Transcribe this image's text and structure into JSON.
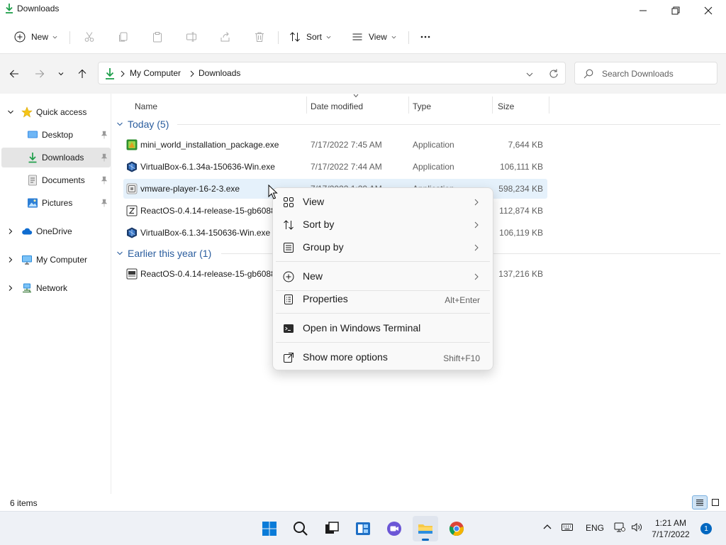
{
  "window": {
    "title": "Downloads"
  },
  "command_bar": {
    "new_label": "New",
    "sort_label": "Sort",
    "view_label": "View"
  },
  "address": {
    "crumbs": [
      "My Computer",
      "Downloads"
    ],
    "search_placeholder": "Search Downloads"
  },
  "nav": {
    "quick_access": "Quick access",
    "items": [
      {
        "label": "Desktop",
        "pinned": true
      },
      {
        "label": "Downloads",
        "pinned": true,
        "selected": true
      },
      {
        "label": "Documents",
        "pinned": true
      },
      {
        "label": "Pictures",
        "pinned": true
      }
    ],
    "onedrive": "OneDrive",
    "my_computer": "My Computer",
    "network": "Network"
  },
  "columns": {
    "name": "Name",
    "date": "Date modified",
    "type": "Type",
    "size": "Size"
  },
  "groups": [
    {
      "label": "Today (5)",
      "files": [
        {
          "name": "mini_world_installation_package.exe",
          "date": "7/17/2022 7:45 AM",
          "type": "Application",
          "size": "7,644 KB",
          "icon": "mini-world-app-icon"
        },
        {
          "name": "VirtualBox-6.1.34a-150636-Win.exe",
          "date": "7/17/2022 7:44 AM",
          "type": "Application",
          "size": "106,111 KB",
          "icon": "virtualbox-icon"
        },
        {
          "name": "vmware-player-16-2-3.exe",
          "date": "7/17/2022 1:20 AM",
          "type": "Application",
          "size": "598,234 KB",
          "icon": "vmware-icon"
        },
        {
          "name": "ReactOS-0.4.14-release-15-gb6088a",
          "date": "",
          "type": "",
          "size": "112,874 KB",
          "icon": "zip-archive-icon"
        },
        {
          "name": "VirtualBox-6.1.34-150636-Win.exe",
          "date": "",
          "type": "",
          "size": "106,119 KB",
          "icon": "virtualbox-icon"
        }
      ]
    },
    {
      "label": "Earlier this year (1)",
      "files": [
        {
          "name": "ReactOS-0.4.14-release-15-gb6088a",
          "date": "",
          "type": "",
          "size": "137,216 KB",
          "icon": "iso-disc-icon"
        }
      ]
    }
  ],
  "status": {
    "item_count": "6 items"
  },
  "context_menu": {
    "items": [
      {
        "label": "View",
        "submenu": true,
        "icon": "view-grid-icon"
      },
      {
        "label": "Sort by",
        "submenu": true,
        "icon": "sort-icon"
      },
      {
        "label": "Group by",
        "submenu": true,
        "icon": "group-by-icon"
      },
      {
        "label": "New",
        "submenu": true,
        "icon": "new-plus-icon"
      },
      {
        "label": "Properties",
        "shortcut": "Alt+Enter",
        "icon": "properties-icon"
      },
      {
        "label": "Open in Windows Terminal",
        "icon": "terminal-icon"
      },
      {
        "label": "Show more options",
        "shortcut": "Shift+F10",
        "icon": "more-options-icon"
      }
    ]
  },
  "taskbar": {
    "language": "ENG",
    "time": "1:21 AM",
    "date": "7/17/2022",
    "notifications": "1"
  },
  "colors": {
    "accent": "#0067c0",
    "group_header": "#2a5d9e",
    "selection": "#e5e5e5",
    "hover_row": "#e5f1fb"
  }
}
